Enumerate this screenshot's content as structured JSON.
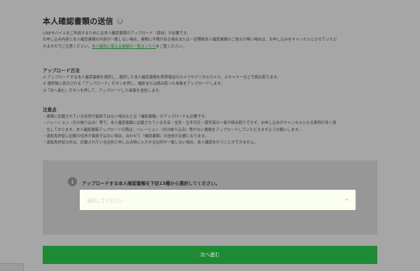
{
  "page": {
    "title": "本人確認書類の送信",
    "help_glyph": "?"
  },
  "intro": {
    "line1": "LINEモバイルをご利用するためには本人確認書類のアップロード（提出）が必要です。",
    "line2": "お申し込み内容と本人確認書類の内容が一致しない場合、書類に不備がある場合または一定期間本人確認書類のご提示が無い場合は、お申し込みをキャンセルとさせていただ",
    "line3_before": "きますのでご注意ください。",
    "line3_link": "本人確認に使える書類の一覧はこちら",
    "line3_after": "をご覧ください。"
  },
  "upload_method": {
    "heading": "アップロード方法",
    "steps": [
      "①  アップロードする本人確認書類を選択し、選択した本人確認書類を携帯電話のカメラやデジタルカメラ、スキャナーなどで読み取ります。",
      "②  選択後に表示される「アップロード」ボタンを押し、撮影または読み取った画像をアップロードします。",
      "③「次へ進む」ボタンを押して、アップロードした画像を送信します。"
    ]
  },
  "notes": {
    "heading": "注意点",
    "items": [
      "・書類に記載されている住所が最新ではない場合などは「補助書類」のアップロードも必要です。",
      "・ハレーション（光の映り込み）等で、本人確認書類に記載されている氏名・住所・生年月日・顔写真の一部が読み取りできず、お申し込みがキャンセルとなる事例が多く発",
      "　生しております。本人確認書類アップロードの際は、ハレーション（光の映り込み）等がない書類をアップロードしていただきますようお願いします。",
      "・運転免許証に記載の住所が最新ではない場合、合わせて「補助書類」の送信が必要になります。",
      "・運転免許証以外は、記載されている住所と申し込み時に入力する住所が一致しない場合、本人確認を行うことができません。"
    ]
  },
  "document_select": {
    "step_number": "1",
    "label": "アップロードする本人確認書類を下記13種から選択してください。",
    "placeholder": "選択してください"
  },
  "actions": {
    "next_label": "次へ進む"
  }
}
